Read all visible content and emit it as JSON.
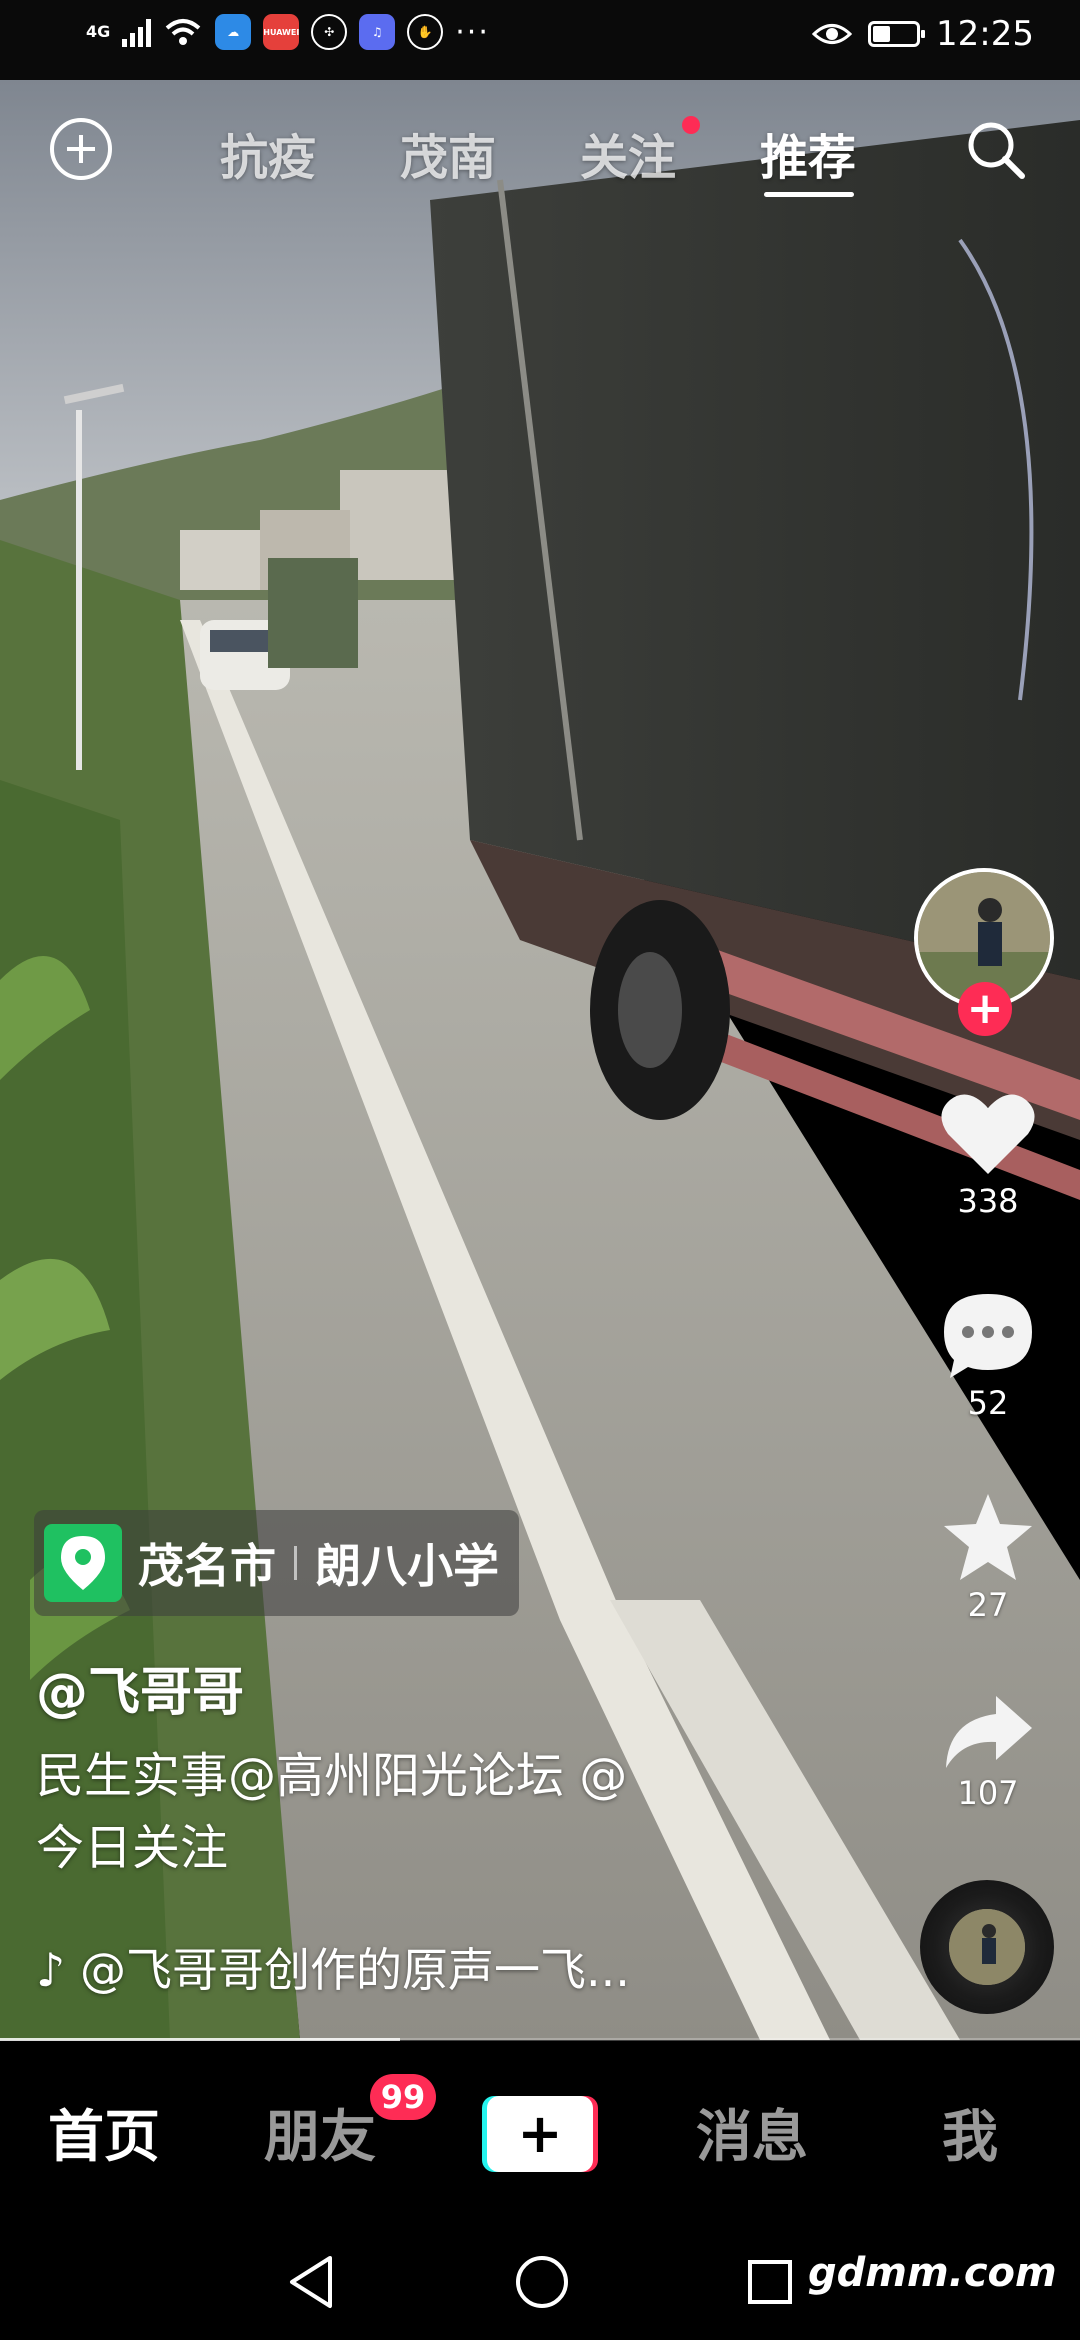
{
  "status_bar": {
    "network": "4G",
    "time": "12:25",
    "battery_level": 0.4,
    "app_icons": [
      "weather-icon",
      "huawei-icon",
      "vpn-icon",
      "music-icon",
      "hand-icon"
    ],
    "huawei_label": "HUAWEI",
    "more": "···"
  },
  "top_nav": {
    "tabs": [
      "抗疫",
      "茂南",
      "关注",
      "推荐"
    ],
    "active_tab": "推荐"
  },
  "rail": {
    "likes": "338",
    "comments": "52",
    "favorites": "27",
    "shares": "107",
    "follow_symbol": "+"
  },
  "video_info": {
    "location_city": "茂名市",
    "location_place": "朗八小学",
    "author": "@飞哥哥",
    "description_line1": "民生实事@高州阳光论坛 @",
    "description_line2": "今日关注",
    "music_note": "♪",
    "music": "@飞哥哥创作的原声一飞..."
  },
  "playback": {
    "progress": 0.37
  },
  "bottom_tabs": {
    "home": "首页",
    "friends": "朋友",
    "friends_badge": "99",
    "create": "+",
    "messages": "消息",
    "me": "我"
  },
  "system_nav": {
    "watermark": "gdmm.com"
  },
  "colors": {
    "accent_red": "#fe2c55",
    "accent_cyan": "#25f4ee",
    "location_green": "#1fc161"
  }
}
